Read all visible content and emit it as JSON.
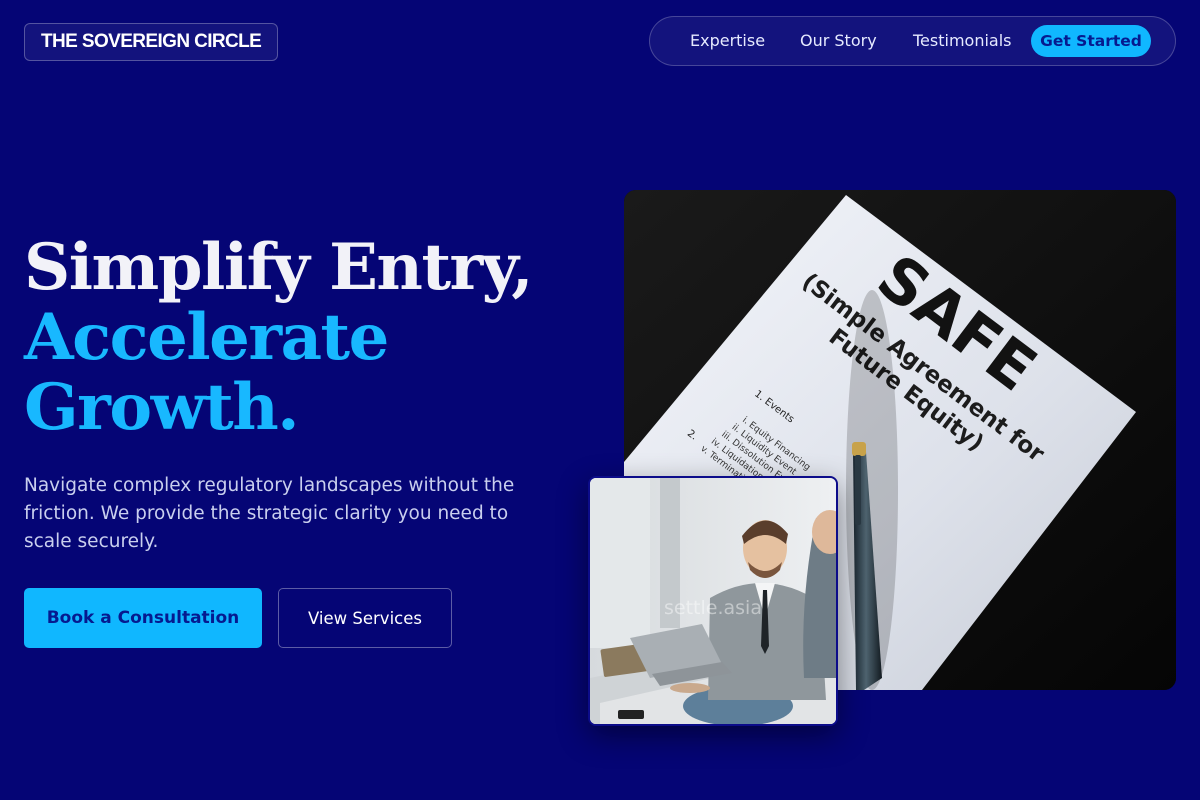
{
  "brand": {
    "name": "THE SOVEREIGN CIRCLE"
  },
  "nav": {
    "items": [
      "Expertise",
      "Our Story",
      "Testimonials"
    ],
    "cta": "Get Started"
  },
  "hero": {
    "line1": "Simplify Entry,",
    "line2": "Accelerate",
    "line3": "Growth.",
    "subtitle": "Navigate complex regulatory landscapes without the friction. We provide the strategic clarity you need to scale securely.",
    "primary_cta": "Book a Consultation",
    "secondary_cta": "View Services"
  },
  "document_image": {
    "title": "SAFE",
    "subtitle_line1": "(Simple Agreement for",
    "subtitle_line2": "Future Equity)",
    "section": "1. Events",
    "items": [
      "i. Equity Financing",
      "ii. Liquidity Event",
      "iii. Dissolution Event",
      "iv. Liquidation Priority",
      "v. Termination"
    ],
    "section2": "2."
  },
  "photo_image": {
    "watermark": "settle.asia"
  },
  "colors": {
    "background": "#050575",
    "accent": "#10b7ff",
    "accent_text": "#061a8f"
  }
}
